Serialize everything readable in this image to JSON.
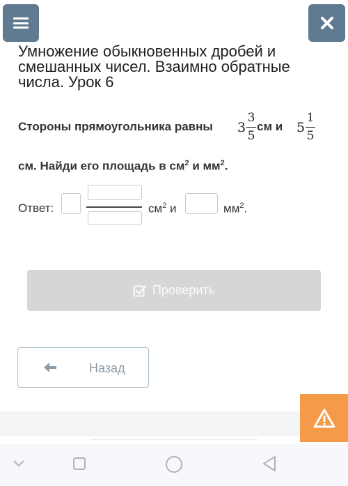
{
  "header": {
    "title": "Умножение обыкновенных дробей и смешанных чисел. Взаимно обратные числа. Урок 6"
  },
  "task": {
    "part1": "Стороны прямоугольника равны",
    "side1": {
      "whole": "3",
      "numerator": "3",
      "denominator": "5"
    },
    "unit1": "см и",
    "side2": {
      "whole": "5",
      "numerator": "1",
      "denominator": "5"
    },
    "part2": "см. Найди его площадь в см",
    "conj": "и мм",
    "exp": "2",
    "end": "."
  },
  "answer": {
    "label": "Ответ:",
    "unit_cm": "см",
    "exp": "2",
    "and": "и",
    "unit_mm": "мм",
    "end": "."
  },
  "buttons": {
    "check": "Проверить",
    "back": "Назад"
  },
  "colors": {
    "header_button": "#5f7a91",
    "check_button_disabled": "#d6d6d6",
    "warning": "#f49a48",
    "back_border": "#a9bccb"
  }
}
